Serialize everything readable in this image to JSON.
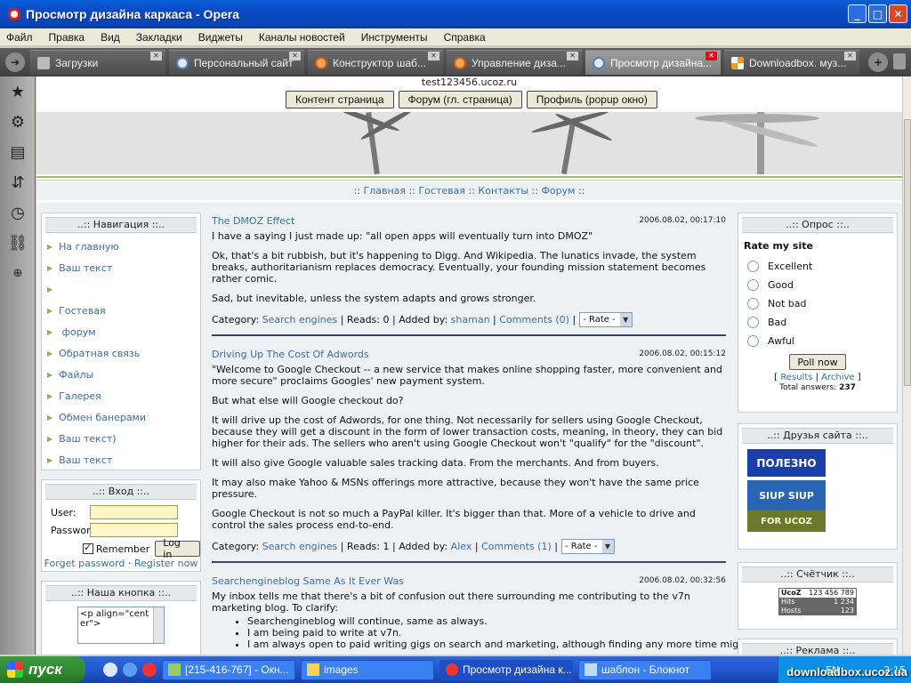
{
  "window": {
    "title": "Просмотр дизайна каркаса - Opera"
  },
  "menu": [
    "Файл",
    "Правка",
    "Вид",
    "Закладки",
    "Виджеты",
    "Каналы новостей",
    "Инструменты",
    "Справка"
  ],
  "tabs": [
    {
      "label": "Загрузки",
      "icon": "download-icon",
      "active": false
    },
    {
      "label": "Персональный сайт",
      "icon": "opera-icon",
      "active": false
    },
    {
      "label": "Конструктор шаб...",
      "icon": "opera-icon",
      "active": false
    },
    {
      "label": "Управление диза...",
      "icon": "opera-icon",
      "active": false
    },
    {
      "label": "Просмотр дизайна...",
      "icon": "opera-icon",
      "active": true
    },
    {
      "label": "Downloadbox. муз...",
      "icon": "downloadbox-icon",
      "active": false
    }
  ],
  "page": {
    "domain": "test123456.ucoz.ru",
    "top_buttons": [
      "Контент страница",
      "Форум (гл. страница)",
      "Профиль (popup окно)"
    ],
    "nav_links": [
      "Главная",
      "Гостевая",
      "Контакты",
      "Форум"
    ],
    "nav_sep": "::"
  },
  "sidebar": {
    "nav_title": "..:: Навигация ::..",
    "nav_items": [
      "На главную",
      "Ваш текст",
      "",
      "Гостевая",
      " форум",
      "Обратная связь",
      "Файлы",
      "Галерея",
      "Обмен банерами",
      "Ваш текст)",
      "Ваш текст"
    ],
    "login_title": "..:: Вход ::..",
    "user_label": "User:",
    "password_label": "Password:",
    "remember_label": "Remember",
    "login_button": "Log in",
    "forgot_link": "Forget password",
    "register_link": "Register now",
    "link_sep": "·",
    "button_title": "..:: Наша кнопка ::..",
    "button_code": "<p align=\"center\">"
  },
  "posts": [
    {
      "title": "The DMOZ Effect",
      "date": "2006.08.02, 00:17:10",
      "paragraphs": [
        "I have a saying I just made up: \"all open apps will eventually turn into DMOZ\"",
        "Ok, that's a bit rubbish, but it's happening to Digg. And Wikipedia. The lunatics invade, the system breaks, authoritarianism replaces democracy. Eventually, your founding mission statement becomes rather comic.",
        "Sad, but inevitable, unless the system adapts and grows stronger."
      ],
      "category": "Search engines",
      "reads": "0",
      "author": "shaman",
      "comments": "Comments (0)"
    },
    {
      "title": "Driving Up The Cost Of Adwords",
      "date": "2006.08.02, 00:15:12",
      "paragraphs": [
        "\"Welcome to Google Checkout -- a new service that makes online shopping faster, more convenient and more secure\" proclaims Googles' new payment system.",
        "But what else will Google checkout do?",
        "It will drive up the cost of Adwords, for one thing. Not necessarily for sellers using Google Checkout, because they will get a discount in the form of lower transaction costs, meaning, in theory, they can bid higher for their ads. The sellers who aren't using Google Checkout won't \"qualify\" for the \"discount\".",
        "It will also give Google valuable sales tracking data. From the merchants. And from buyers.",
        "It may also make Yahoo & MSNs offerings more attractive, because they won't have the same price pressure.",
        "Google Checkout is not so much a PayPal killer. It's bigger than that. More of a vehicle to drive and control the sales process end-to-end."
      ],
      "category": "Search engines",
      "reads": "1",
      "author": "Alex",
      "comments": "Comments (1)"
    },
    {
      "title": "Searchengineblog Same As It Ever Was",
      "date": "2006.08.02, 00:32:56",
      "paragraphs": [
        "My inbox tells me that there's a bit of confusion out there surrounding me contributing to the v7n marketing blog. To clarify:"
      ],
      "bullets": [
        "Searchengineblog will continue, same as always.",
        "I am being paid to write at v7n.",
        "I am always open to paid writing gigs on search and marketing, although finding any more time might be a"
      ]
    }
  ],
  "post_labels": {
    "category": "Category:",
    "reads": "Reads:",
    "added_by": "Added by:",
    "rate": "- Rate -",
    "sep": "|"
  },
  "poll": {
    "title": "..:: Опрос ::..",
    "question": "Rate my site",
    "options": [
      "Excellent",
      "Good",
      "Not bad",
      "Bad",
      "Awful"
    ],
    "button": "Poll now",
    "results": "Results",
    "archive": "Archive",
    "total_label": "Total answers:",
    "total": "237"
  },
  "friends": {
    "title": "..:: Друзья сайта ::..",
    "banner1": "ПОЛЕЗНО",
    "banner2": "SIUP SIUP",
    "banner3": "FOR UCOZ"
  },
  "counter": {
    "title": "..:: Счётчик ::..",
    "brand": "UcoZ",
    "number": "123 456 789",
    "hits_label": "Hits",
    "hits": "1 234",
    "hosts_label": "Hosts",
    "hosts": "123"
  },
  "ads": {
    "title": "..:: Реклама ::.."
  },
  "taskbar": {
    "start": "пуск",
    "tasks": [
      "[215-416-767] - Окн...",
      "images",
      "Просмотр дизайна к...",
      "шаблон - Блокнот"
    ],
    "clock": "2:15",
    "lang": "EN",
    "watermark": "downloadbox.ucoz.ua"
  },
  "colors": {
    "link": "#3a6ea5",
    "accent_green": "#9bbf63",
    "divider": "#33466b"
  }
}
